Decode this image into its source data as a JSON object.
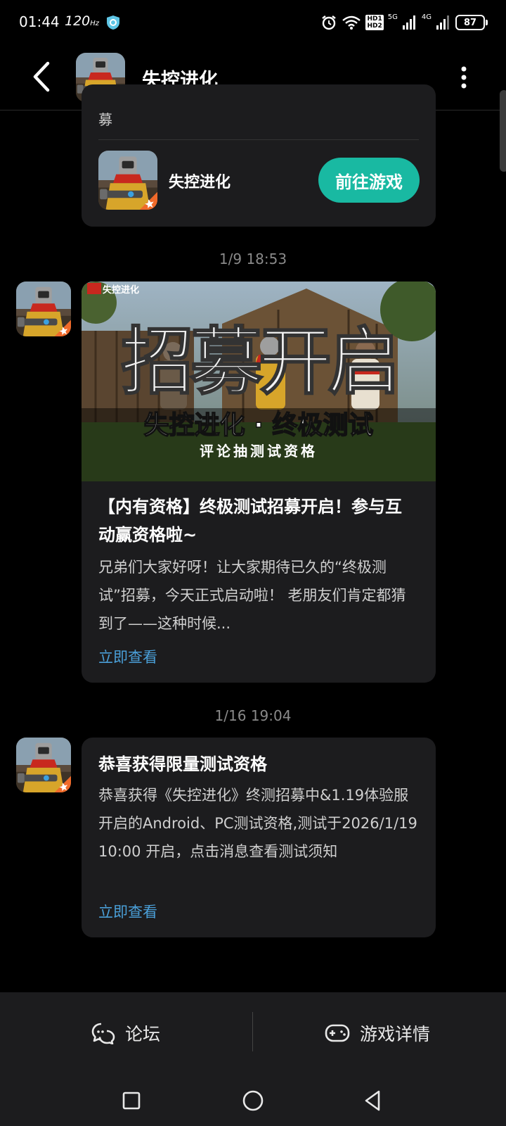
{
  "status_bar": {
    "time": "01:44",
    "refresh_rate": "120",
    "refresh_unit": "Hz",
    "hd_labels": [
      "HD1",
      "HD2"
    ],
    "network_1": "5G",
    "network_2": "4G",
    "battery": "87"
  },
  "header": {
    "title": "失控进化",
    "back_icon": "chevron-left-icon",
    "more_icon": "more-vertical-icon"
  },
  "messages": [
    {
      "type": "game_card",
      "top_text": "募",
      "game_name": "失控进化",
      "action_label": "前往游戏",
      "action_color": "#19b9a2"
    },
    {
      "timestamp": "1/9  18:53",
      "banner": {
        "logo_text": "失控进化",
        "headline": "招募开启",
        "subtitle": "失控进化 · 终极测试",
        "tagline": "评论抽测试资格"
      },
      "title": "【内有资格】终极测试招募开启！参与互动赢资格啦~",
      "body": "兄弟们大家好呀！让大家期待已久的“终极测试”招募，今天正式启动啦！ 老朋友们肯定都猜到了——这种时候...",
      "link": "立即查看"
    },
    {
      "timestamp": "1/16  19:04",
      "title": "恭喜获得限量测试资格",
      "body": "恭喜获得《失控进化》终测招募中&1.19体验服开启的Android、PC测试资格,测试于2026/1/19 10:00 开启，点击消息查看测试须知",
      "link": "立即查看"
    }
  ],
  "bottom_bar": {
    "forum_label": "论坛",
    "forum_icon": "chat-bubbles-icon",
    "details_label": "游戏详情",
    "details_icon": "gamepad-icon"
  },
  "nav_bar": {
    "recent_icon": "square-icon",
    "home_icon": "circle-icon",
    "back_icon": "triangle-back-icon"
  },
  "colors": {
    "background": "#000000",
    "card": "#1c1c1e",
    "accent": "#19b9a2",
    "link": "#4a9fd8"
  }
}
